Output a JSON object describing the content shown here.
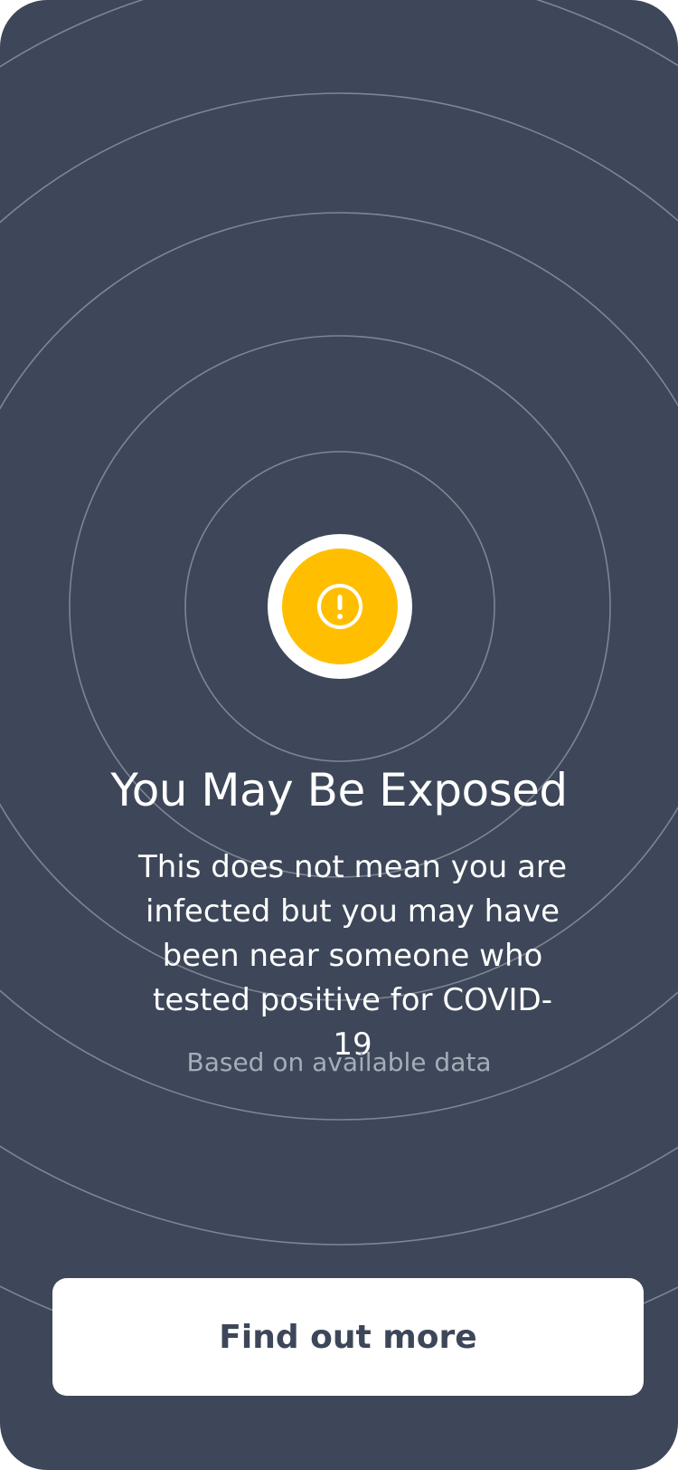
{
  "status": {
    "icon": "exclamation-circle-icon",
    "color": "#ffbf00"
  },
  "title": "You May Be Exposed",
  "body_lines": [
    "This does not mean you are",
    "infected but you may have",
    "been near someone who",
    "tested positive for COVID-19"
  ],
  "note": "Based on available data",
  "cta": {
    "label": "Find out more"
  },
  "colors": {
    "background": "#3d4759",
    "ring": "#8a909c",
    "button": "#ffffff",
    "button_text": "#3d4759"
  }
}
